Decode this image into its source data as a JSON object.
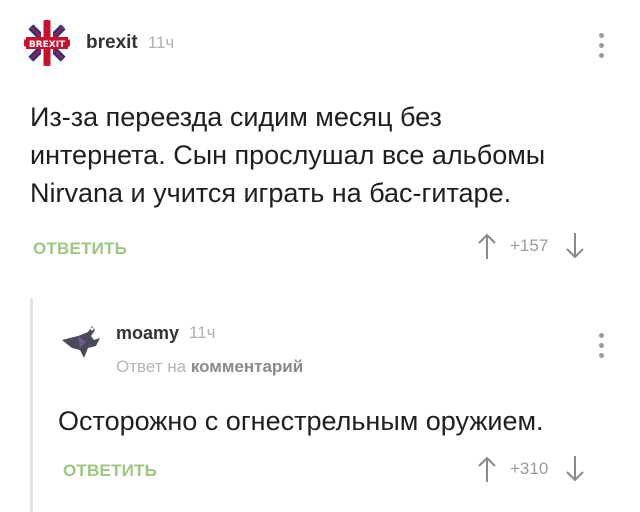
{
  "comments": [
    {
      "username": "brexit",
      "time": "11ч",
      "avatar_icon": "brexit-flag-icon",
      "text_lines": [
        "Из-за переезда сидим месяц без",
        "интернета. Сын прослушал все альбомы",
        "Nirvana и учится играть на бас-гитаре."
      ],
      "reply_label": "ОТВЕТИТЬ",
      "rating": "+157"
    },
    {
      "username": "moamy",
      "time": "11ч",
      "avatar_icon": "bird-avatar-icon",
      "meta_prefix": "Ответ на",
      "meta_link": "комментарий",
      "text_lines": [
        "Осторожно с огнестрельным оружием."
      ],
      "reply_label": "ОТВЕТИТЬ",
      "rating": "+310"
    }
  ],
  "colors": {
    "reply_green": "#9bc77f",
    "muted": "#b0b0b0",
    "text": "#1f1f1f"
  }
}
